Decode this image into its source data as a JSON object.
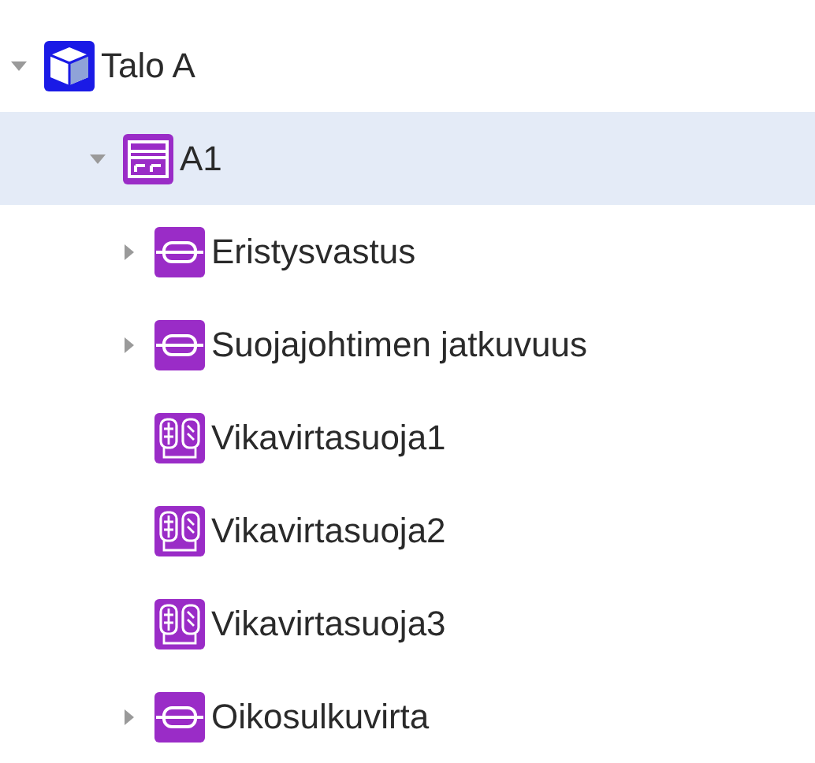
{
  "tree": [
    {
      "label": "Talo A",
      "kind": "building",
      "expanded": true,
      "selected": false,
      "children": [
        {
          "label": "A1",
          "kind": "board",
          "expanded": true,
          "selected": true,
          "children": [
            {
              "label": "Eristysvastus",
              "kind": "test",
              "expanded": false,
              "selected": false
            },
            {
              "label": "Suojajohtimen jatkuvuus",
              "kind": "test",
              "expanded": false,
              "selected": false
            },
            {
              "label": "Vikavirtasuoja1",
              "kind": "rcd",
              "selected": false
            },
            {
              "label": "Vikavirtasuoja2",
              "kind": "rcd",
              "selected": false
            },
            {
              "label": "Vikavirtasuoja3",
              "kind": "rcd",
              "selected": false
            },
            {
              "label": "Oikosulkuvirta",
              "kind": "test",
              "expanded": false,
              "selected": false
            }
          ]
        }
      ]
    }
  ]
}
